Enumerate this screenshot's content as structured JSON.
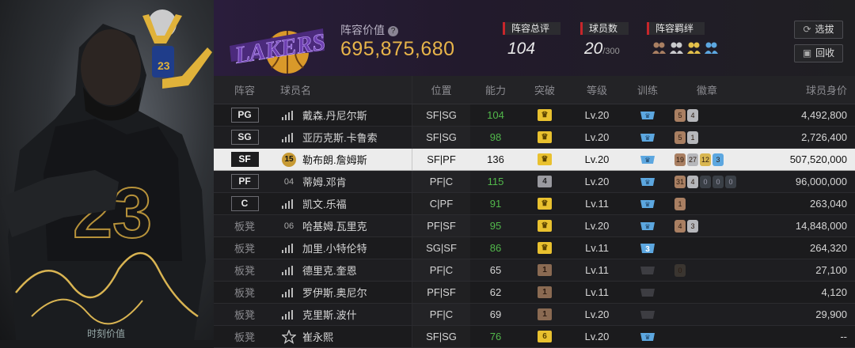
{
  "hero": {
    "caption": "时刻价值"
  },
  "header": {
    "lineup_value_label": "阵容价值",
    "lineup_value": "695,875,680",
    "rating_label": "阵容总评",
    "rating_value": "104",
    "players_label": "球员数",
    "players_value": "20",
    "players_max": "/300",
    "bond_label": "阵容羁绊",
    "select_button": "选拔",
    "recycle_button": "回收",
    "help_glyph": "?"
  },
  "columns": [
    "阵容",
    "球员名",
    "位置",
    "能力",
    "突破",
    "等级",
    "训练",
    "徽章",
    "球员身价"
  ],
  "rows": [
    {
      "slot": "PG",
      "num": "",
      "name": "戴森.丹尼尔斯",
      "pos": "SF|SG",
      "ability": "104",
      "green": true,
      "tp": "gold",
      "tp_text": "",
      "level": "Lv.20",
      "train": "blue",
      "badges": [
        {
          "t": "b",
          "v": "5"
        },
        {
          "t": "s",
          "v": "4"
        }
      ],
      "worth": "4,492,800"
    },
    {
      "slot": "SG",
      "num": "",
      "name": "亚历克斯.卡鲁索",
      "pos": "SF|SG",
      "ability": "98",
      "green": true,
      "tp": "gold",
      "tp_text": "",
      "level": "Lv.20",
      "train": "blue",
      "badges": [
        {
          "t": "b",
          "v": "5"
        },
        {
          "t": "s",
          "v": "1"
        }
      ],
      "worth": "2,726,400"
    },
    {
      "slot": "SF",
      "num": "15",
      "name": "勒布朗.詹姆斯",
      "pos": "SF|PF",
      "ability": "136",
      "green": false,
      "tp": "gold",
      "tp_text": "",
      "level": "Lv.20",
      "train": "blue",
      "badges": [
        {
          "t": "b",
          "v": "19"
        },
        {
          "t": "s",
          "v": "27"
        },
        {
          "t": "g",
          "v": "12"
        },
        {
          "t": "bl",
          "v": "3"
        }
      ],
      "worth": "507,520,000"
    },
    {
      "slot": "PF",
      "num": "04",
      "name": "蒂姆.邓肯",
      "pos": "PF|C",
      "ability": "115",
      "green": true,
      "tp": "grey",
      "tp_text": "4",
      "level": "Lv.20",
      "train": "blue",
      "badges": [
        {
          "t": "b",
          "v": "31"
        },
        {
          "t": "s",
          "v": "4"
        },
        {
          "t": "d",
          "v": "0"
        },
        {
          "t": "d",
          "v": "0"
        },
        {
          "t": "d",
          "v": "0"
        }
      ],
      "worth": "96,000,000"
    },
    {
      "slot": "C",
      "num": "",
      "name": "凯文.乐福",
      "pos": "C|PF",
      "ability": "91",
      "green": true,
      "tp": "gold",
      "tp_text": "",
      "level": "Lv.11",
      "train": "blue",
      "badges": [
        {
          "t": "b",
          "v": "1"
        }
      ],
      "worth": "263,040"
    },
    {
      "slot": "板凳",
      "num": "06",
      "name": "哈基姆.瓦里克",
      "pos": "PF|SF",
      "ability": "95",
      "green": true,
      "tp": "gold",
      "tp_text": "",
      "level": "Lv.20",
      "train": "blue",
      "badges": [
        {
          "t": "b",
          "v": "4"
        },
        {
          "t": "s",
          "v": "3"
        }
      ],
      "worth": "14,848,000"
    },
    {
      "slot": "板凳",
      "num": "",
      "name": "加里.小特伦特",
      "pos": "SG|SF",
      "ability": "86",
      "green": true,
      "tp": "gold",
      "tp_text": "",
      "level": "Lv.11",
      "train": "blue3",
      "badges": [],
      "worth": "264,320"
    },
    {
      "slot": "板凳",
      "num": "",
      "name": "德里克.奎恩",
      "pos": "PF|C",
      "ability": "65",
      "green": false,
      "tp": "bronze",
      "tp_text": "1",
      "level": "Lv.11",
      "train": "dark",
      "badges": [
        {
          "t": "empty",
          "v": "0"
        }
      ],
      "worth": "27,100"
    },
    {
      "slot": "板凳",
      "num": "",
      "name": "罗伊斯.奥尼尔",
      "pos": "PF|SF",
      "ability": "62",
      "green": false,
      "tp": "bronze",
      "tp_text": "1",
      "level": "Lv.11",
      "train": "dark",
      "badges": [],
      "worth": "4,120"
    },
    {
      "slot": "板凳",
      "num": "",
      "name": "克里斯.波什",
      "pos": "PF|C",
      "ability": "69",
      "green": false,
      "tp": "bronze",
      "tp_text": "1",
      "level": "Lv.20",
      "train": "dark",
      "badges": [],
      "worth": "29,900"
    },
    {
      "slot": "板凳",
      "num": "star",
      "name": "崔永熙",
      "pos": "SF|SG",
      "ability": "76",
      "green": true,
      "tp": "gold",
      "tp_text": "6",
      "level": "Lv.20",
      "train": "blue",
      "badges": [],
      "worth": "--"
    }
  ]
}
